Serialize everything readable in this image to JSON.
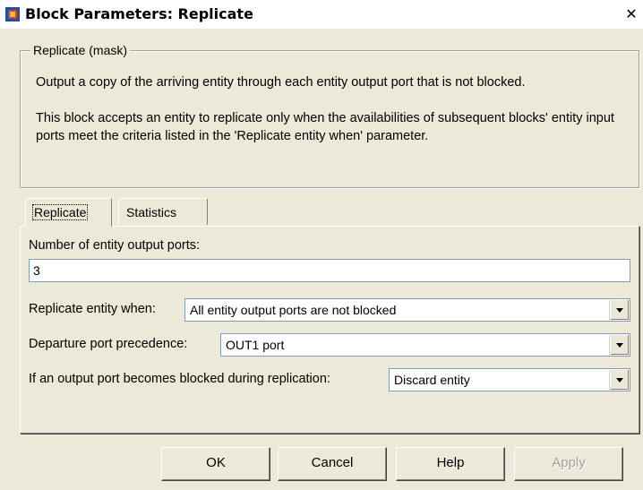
{
  "window": {
    "title": "Block Parameters: Replicate",
    "close_icon": "close-icon",
    "app_icon": "simulink-block-icon"
  },
  "mask": {
    "legend": "Replicate (mask)",
    "description_1": "Output a copy of the arriving entity through each entity output port that is not blocked.",
    "description_2": "This block accepts an entity to replicate only when the availabilities of subsequent blocks' entity input ports meet the criteria listed in the 'Replicate entity when' parameter."
  },
  "tabs": [
    {
      "label": "Replicate",
      "active": true
    },
    {
      "label": "Statistics",
      "active": false
    }
  ],
  "params": {
    "num_ports_label": "Number of entity output ports:",
    "num_ports_value": "3",
    "replicate_when_label": "Replicate entity when:",
    "replicate_when_value": "All entity output ports are not blocked",
    "departure_label": "Departure port precedence:",
    "departure_value": "OUT1 port",
    "blocked_label": "If an output port becomes blocked during replication:",
    "blocked_value": "Discard entity"
  },
  "buttons": {
    "ok": "OK",
    "cancel": "Cancel",
    "help": "Help",
    "apply": "Apply"
  }
}
